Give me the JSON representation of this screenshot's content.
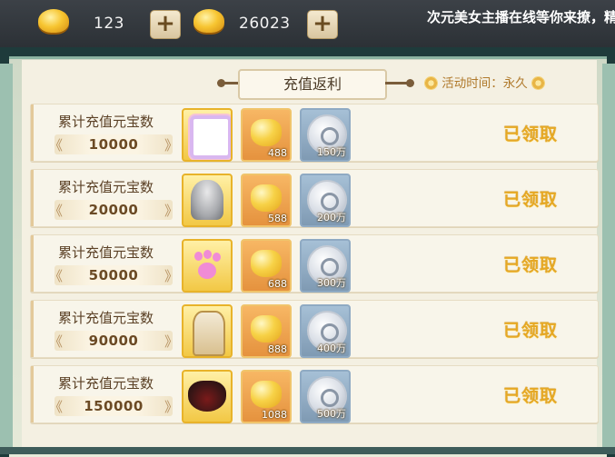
{
  "topbar": {
    "gold_ingot_value": "123",
    "coin_value": "26023",
    "marquee": "次元美女主播在线等你来撩，精"
  },
  "panel": {
    "title": "充值返利",
    "event_time": "活动时间：永久"
  },
  "rows": [
    {
      "label": "累计充值元宝数",
      "amount": "10000",
      "items": [
        {
          "icon": "avatar-frame",
          "qty": ""
        },
        {
          "icon": "gold-ingot",
          "qty": "488"
        },
        {
          "icon": "silver-coin",
          "qty": "150万"
        }
      ],
      "status": "已领取"
    },
    {
      "label": "累计充值元宝数",
      "amount": "20000",
      "items": [
        {
          "icon": "hair-avatar",
          "qty": ""
        },
        {
          "icon": "gold-ingot",
          "qty": "588"
        },
        {
          "icon": "silver-coin",
          "qty": "200万"
        }
      ],
      "status": "已领取"
    },
    {
      "label": "累计充值元宝数",
      "amount": "50000",
      "items": [
        {
          "icon": "paw-effect",
          "qty": ""
        },
        {
          "icon": "gold-ingot",
          "qty": "688"
        },
        {
          "icon": "silver-coin",
          "qty": "300万"
        }
      ],
      "status": "已领取"
    },
    {
      "label": "累计充值元宝数",
      "amount": "90000",
      "items": [
        {
          "icon": "costume",
          "qty": ""
        },
        {
          "icon": "gold-ingot",
          "qty": "888"
        },
        {
          "icon": "silver-coin",
          "qty": "400万"
        }
      ],
      "status": "已领取"
    },
    {
      "label": "累计充值元宝数",
      "amount": "150000",
      "items": [
        {
          "icon": "dark-wings",
          "qty": ""
        },
        {
          "icon": "gold-ingot",
          "qty": "1088"
        },
        {
          "icon": "silver-coin",
          "qty": "500万"
        }
      ],
      "status": "已领取"
    }
  ],
  "colors": {
    "claimed_text": "#e6a824",
    "panel_frame": "#9cc0b0",
    "row_bg": "#f8f5ea"
  }
}
